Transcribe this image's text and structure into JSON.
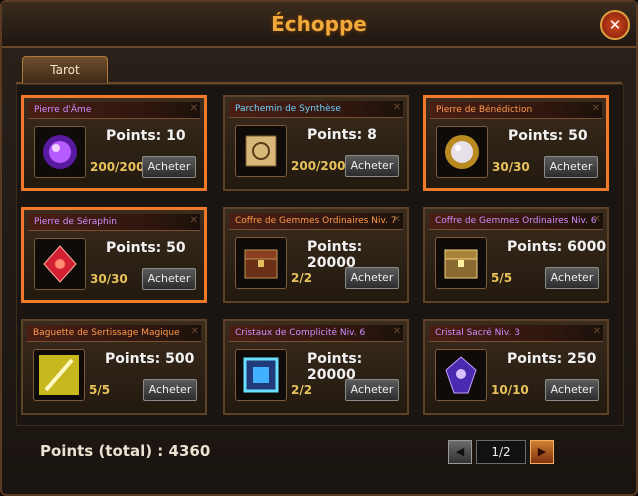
{
  "window": {
    "title": "Échoppe",
    "close_label": "✕"
  },
  "tabs": [
    {
      "label": "Tarot"
    }
  ],
  "items": [
    {
      "name": "Pierre d'Âme",
      "name_color": "purple",
      "points_label": "Points:",
      "points": "10",
      "quantity": "200/200",
      "buy_label": "Acheter",
      "icon": "purple-orb-icon",
      "selected": true
    },
    {
      "name": "Parchemin de Synthèse",
      "name_color": "blue",
      "points_label": "Points:",
      "points": "8",
      "quantity": "200/200",
      "buy_label": "Acheter",
      "icon": "scroll-icon",
      "selected": false
    },
    {
      "name": "Pierre de Bénédiction",
      "name_color": "orange",
      "points_label": "Points:",
      "points": "50",
      "quantity": "30/30",
      "buy_label": "Acheter",
      "icon": "pearl-icon",
      "selected": true
    },
    {
      "name": "Pierre de Séraphin",
      "name_color": "purple",
      "points_label": "Points:",
      "points": "50",
      "quantity": "30/30",
      "buy_label": "Acheter",
      "icon": "red-gem-icon",
      "selected": true
    },
    {
      "name": "Coffre de Gemmes Ordinaires Niv. 7",
      "name_color": "orange",
      "points_label": "Points:",
      "points": "20000",
      "quantity": "2/2",
      "buy_label": "Acheter",
      "icon": "chest-icon",
      "selected": false
    },
    {
      "name": "Coffre de Gemmes Ordinaires Niv. 6",
      "name_color": "purple",
      "points_label": "Points:",
      "points": "6000",
      "quantity": "5/5",
      "buy_label": "Acheter",
      "icon": "chest-gold-icon",
      "selected": false
    },
    {
      "name": "Baguette de Sertissage Magique",
      "name_color": "orange",
      "points_label": "Points:",
      "points": "500",
      "quantity": "5/5",
      "buy_label": "Acheter",
      "icon": "wand-icon",
      "selected": false
    },
    {
      "name": "Cristaux de Complicité Niv. 6",
      "name_color": "purple",
      "points_label": "Points:",
      "points": "20000",
      "quantity": "2/2",
      "buy_label": "Acheter",
      "icon": "crystal-frame-icon",
      "selected": false
    },
    {
      "name": "Cristal Sacré Niv. 3",
      "name_color": "purple",
      "points_label": "Points:",
      "points": "250",
      "quantity": "10/10",
      "buy_label": "Acheter",
      "icon": "sacred-crystal-icon",
      "selected": false
    }
  ],
  "footer": {
    "total_label": "Points (total) : 4360",
    "page": "1/2",
    "prev_label": "◀",
    "next_label": "▶"
  }
}
